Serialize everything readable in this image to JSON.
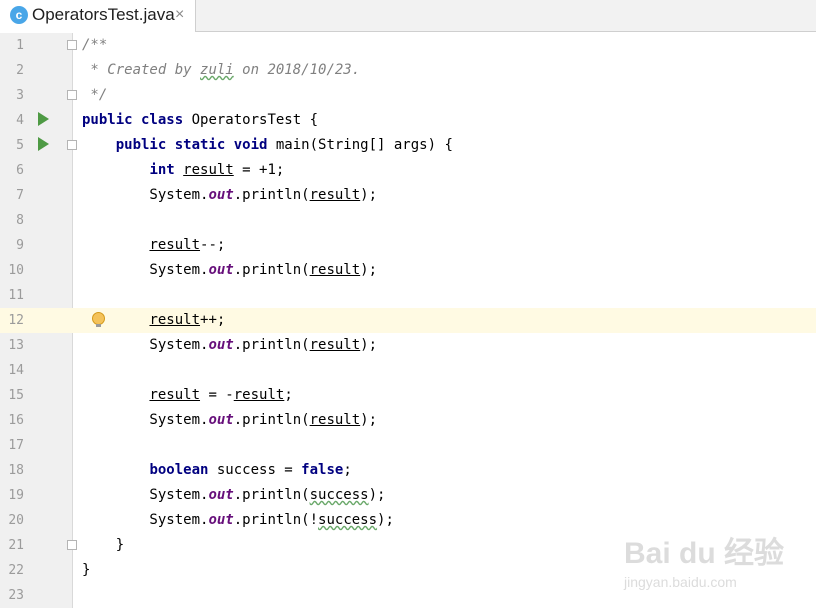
{
  "tab": {
    "icon": "class-icon",
    "icon_letter": "c",
    "title": "OperatorsTest.java",
    "close": "×"
  },
  "editor": {
    "current_line": 12,
    "run_gutter_lines": [
      4,
      5
    ],
    "intention_bulb_line": 12,
    "lines": [
      {
        "n": "1",
        "tokens": [
          {
            "t": "/**",
            "c": "cm"
          }
        ]
      },
      {
        "n": "2",
        "tokens": [
          {
            "t": " * Created by ",
            "c": "cm"
          },
          {
            "t": "zuli",
            "c": "cm wavy"
          },
          {
            "t": " on 2018/10/23.",
            "c": "cm"
          }
        ]
      },
      {
        "n": "3",
        "tokens": [
          {
            "t": " */",
            "c": "cm"
          }
        ]
      },
      {
        "n": "4",
        "tokens": [
          {
            "t": "public class",
            "c": "kw"
          },
          {
            "t": " OperatorsTest {"
          }
        ]
      },
      {
        "n": "5",
        "tokens": [
          {
            "t": "    "
          },
          {
            "t": "public static void",
            "c": "kw"
          },
          {
            "t": " main(String[] args) {"
          }
        ]
      },
      {
        "n": "6",
        "tokens": [
          {
            "t": "        "
          },
          {
            "t": "int",
            "c": "kw"
          },
          {
            "t": " "
          },
          {
            "t": "result",
            "c": "ul"
          },
          {
            "t": " = +1;"
          }
        ]
      },
      {
        "n": "7",
        "tokens": [
          {
            "t": "        System."
          },
          {
            "t": "out",
            "c": "fld"
          },
          {
            "t": ".println("
          },
          {
            "t": "result",
            "c": "ul"
          },
          {
            "t": ");"
          }
        ]
      },
      {
        "n": "8",
        "tokens": []
      },
      {
        "n": "9",
        "tokens": [
          {
            "t": "        "
          },
          {
            "t": "result",
            "c": "ul"
          },
          {
            "t": "--;"
          }
        ]
      },
      {
        "n": "10",
        "tokens": [
          {
            "t": "        System."
          },
          {
            "t": "out",
            "c": "fld"
          },
          {
            "t": ".println("
          },
          {
            "t": "result",
            "c": "ul"
          },
          {
            "t": ");"
          }
        ]
      },
      {
        "n": "11",
        "tokens": []
      },
      {
        "n": "12",
        "tokens": [
          {
            "t": "        "
          },
          {
            "t": "result",
            "c": "ul"
          },
          {
            "t": "++;"
          }
        ]
      },
      {
        "n": "13",
        "tokens": [
          {
            "t": "        System."
          },
          {
            "t": "out",
            "c": "fld"
          },
          {
            "t": ".println("
          },
          {
            "t": "result",
            "c": "ul"
          },
          {
            "t": ");"
          }
        ]
      },
      {
        "n": "14",
        "tokens": []
      },
      {
        "n": "15",
        "tokens": [
          {
            "t": "        "
          },
          {
            "t": "result",
            "c": "ul"
          },
          {
            "t": " = -"
          },
          {
            "t": "result",
            "c": "ul"
          },
          {
            "t": ";"
          }
        ]
      },
      {
        "n": "16",
        "tokens": [
          {
            "t": "        System."
          },
          {
            "t": "out",
            "c": "fld"
          },
          {
            "t": ".println("
          },
          {
            "t": "result",
            "c": "ul"
          },
          {
            "t": ");"
          }
        ]
      },
      {
        "n": "17",
        "tokens": []
      },
      {
        "n": "18",
        "tokens": [
          {
            "t": "        "
          },
          {
            "t": "boolean",
            "c": "kw"
          },
          {
            "t": " success = "
          },
          {
            "t": "false",
            "c": "kw"
          },
          {
            "t": ";"
          }
        ]
      },
      {
        "n": "19",
        "tokens": [
          {
            "t": "        System."
          },
          {
            "t": "out",
            "c": "fld"
          },
          {
            "t": ".println("
          },
          {
            "t": "success",
            "c": "wavy"
          },
          {
            "t": ");"
          }
        ]
      },
      {
        "n": "20",
        "tokens": [
          {
            "t": "        System."
          },
          {
            "t": "out",
            "c": "fld"
          },
          {
            "t": ".println(!"
          },
          {
            "t": "success",
            "c": "wavy"
          },
          {
            "t": ");"
          }
        ]
      },
      {
        "n": "21",
        "tokens": [
          {
            "t": "    }"
          }
        ]
      },
      {
        "n": "22",
        "tokens": [
          {
            "t": "}"
          }
        ]
      },
      {
        "n": "23",
        "tokens": []
      }
    ]
  },
  "watermark": {
    "logo": "Bai du 经验",
    "sub": "jingyan.baidu.com"
  }
}
